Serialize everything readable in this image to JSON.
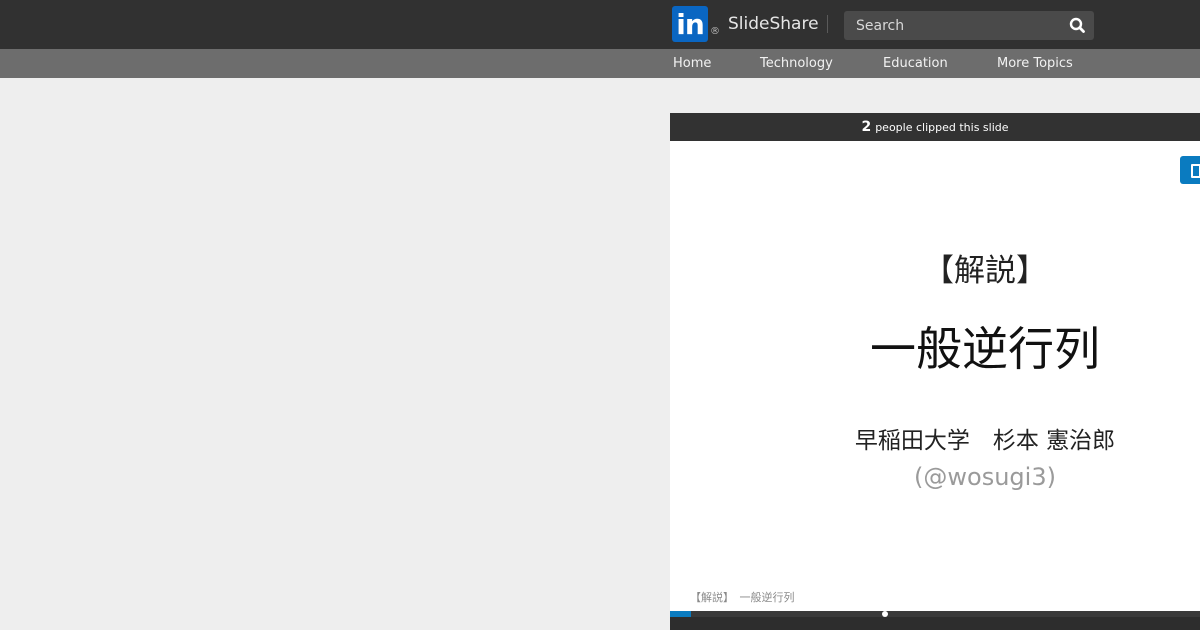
{
  "header": {
    "logo_text": "in",
    "logo_registered": "®",
    "brand": "SlideShare",
    "search": {
      "placeholder": "Search",
      "value": ""
    },
    "icons": {
      "search": "search-icon"
    },
    "colors": {
      "bar": "#313131",
      "linkedin_blue": "#0a66c2"
    }
  },
  "nav": {
    "items": [
      {
        "label": "Home"
      },
      {
        "label": "Technology"
      },
      {
        "label": "Education"
      },
      {
        "label": "More Topics"
      }
    ]
  },
  "player": {
    "clip_count": "2",
    "clip_text": "people clipped this slide",
    "clip_button_icon": "clip-icon",
    "slide": {
      "tag": "【解説】",
      "title": "一般逆行列",
      "author": "早稲田大学　杉本 憲治郎",
      "handle": "(@wosugi3)",
      "footer": "【解説】　一般逆行列"
    },
    "progress_fraction": 0.04,
    "knob_fraction": 0.4,
    "colors": {
      "accent": "#0a7bc0",
      "clip_bar": "#323232"
    }
  }
}
